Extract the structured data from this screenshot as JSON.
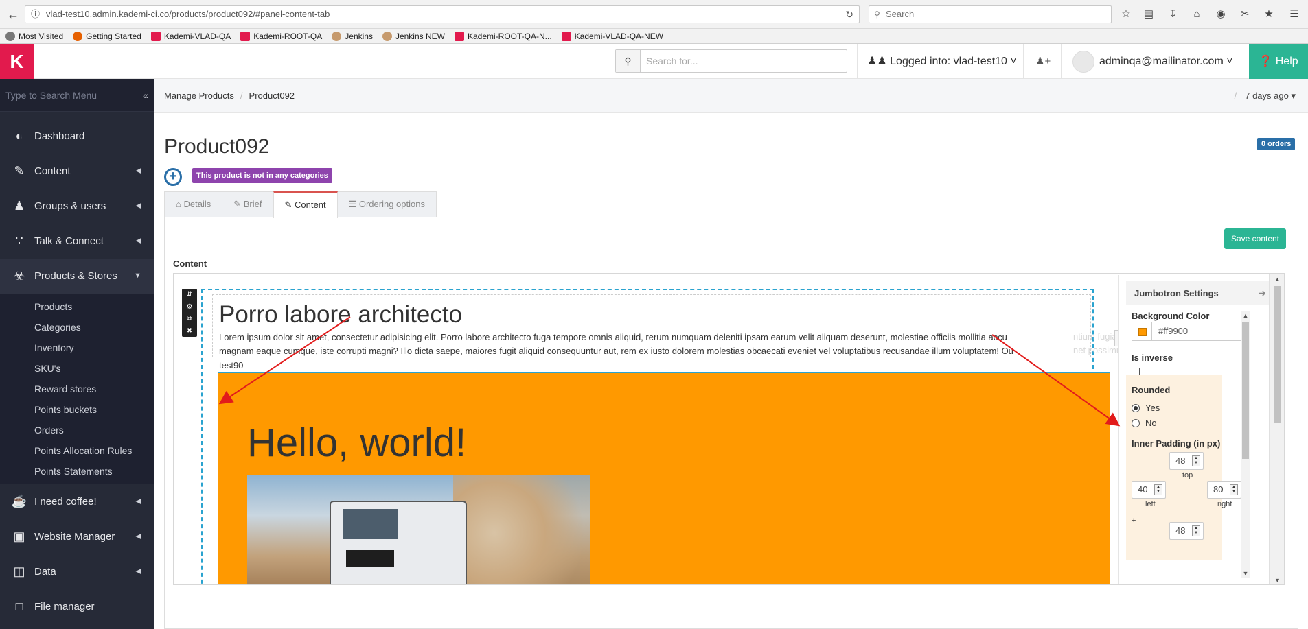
{
  "browser": {
    "url": "vlad-test10.admin.kademi-ci.co/products/product092/#panel-content-tab",
    "search_placeholder": "Search",
    "bookmarks": [
      "Most Visited",
      "Getting Started",
      "Kademi-VLAD-QA",
      "Kademi-ROOT-QA",
      "Jenkins",
      "Jenkins NEW",
      "Kademi-ROOT-QA-N...",
      "Kademi-VLAD-QA-NEW"
    ]
  },
  "header": {
    "search_placeholder": "Search for...",
    "logged_into": "Logged into: vlad-test10",
    "user_email": "adminqa@mailinator.com",
    "help_label": "Help"
  },
  "sidebar": {
    "search_placeholder": "Type to Search Menu",
    "items": [
      {
        "label": "Dashboard",
        "icon": "dashboard-icon"
      },
      {
        "label": "Content",
        "icon": "edit-icon"
      },
      {
        "label": "Groups & users",
        "icon": "users-icon"
      },
      {
        "label": "Talk & Connect",
        "icon": "rss-icon"
      },
      {
        "label": "Products & Stores",
        "icon": "cart-icon"
      },
      {
        "label": "I need coffee!",
        "icon": "coffee-icon"
      },
      {
        "label": "Website Manager",
        "icon": "desktop-icon"
      },
      {
        "label": "Data",
        "icon": "database-icon"
      },
      {
        "label": "File manager",
        "icon": "file-icon"
      }
    ],
    "subitems": [
      "Products",
      "Categories",
      "Inventory",
      "SKU's",
      "Reward stores",
      "Points buckets",
      "Orders",
      "Points Allocation Rules",
      "Points Statements"
    ]
  },
  "breadcrumb": {
    "items": [
      "Manage Products",
      "Product092"
    ],
    "updated": "7 days ago"
  },
  "product": {
    "title": "Product092",
    "orders_badge": "0 orders",
    "category_label": "This product is not in any categories"
  },
  "tabs": [
    "Details",
    "Brief",
    "Content",
    "Ordering options"
  ],
  "content": {
    "save_label": "Save content",
    "content_label": "Content",
    "lead_title": "Porro labore architecto",
    "lead_text": "Lorem ipsum dolor sit amet, consectetur adipisicing elit. Porro labore architecto fuga tempore omnis aliquid, rerum numquam deleniti ipsam earum velit aliquam deserunt, molestiae officiis mollitia accu",
    "lead_text_2": "magnam eaque cumque, iste corrupti magni? Illo dicta saepe, maiores fugit aliquid consequuntur aut, rem ex iusto dolorem molestias obcaecati eveniet vel voluptatibus recusandae illum voluptatem! Ou",
    "ghost_1": "ntium fugiat esse",
    "ghost_2": "net possimus nesciunt",
    "test_label": "test90",
    "jumbo_title": "Hello, world!"
  },
  "settings": {
    "title": "Jumbotron Settings",
    "bg_label": "Background Color",
    "bg_value": "#ff9900",
    "inverse_label": "Is inverse",
    "inverse_checked": false,
    "rounded_label": "Rounded",
    "rounded_yes": "Yes",
    "rounded_no": "No",
    "rounded_value": "Yes",
    "padding_label": "Inner Padding (in px)",
    "pad_top": "48",
    "pad_left": "40",
    "pad_right": "80",
    "pad_bottom": "48",
    "top_label": "top",
    "left_label": "left",
    "right_label": "right",
    "plus_label": "+"
  },
  "colors": {
    "brand": "#e21a4d",
    "help": "#2bb594",
    "jumbotron": "#ff9900",
    "sidebar": "#262a37"
  }
}
